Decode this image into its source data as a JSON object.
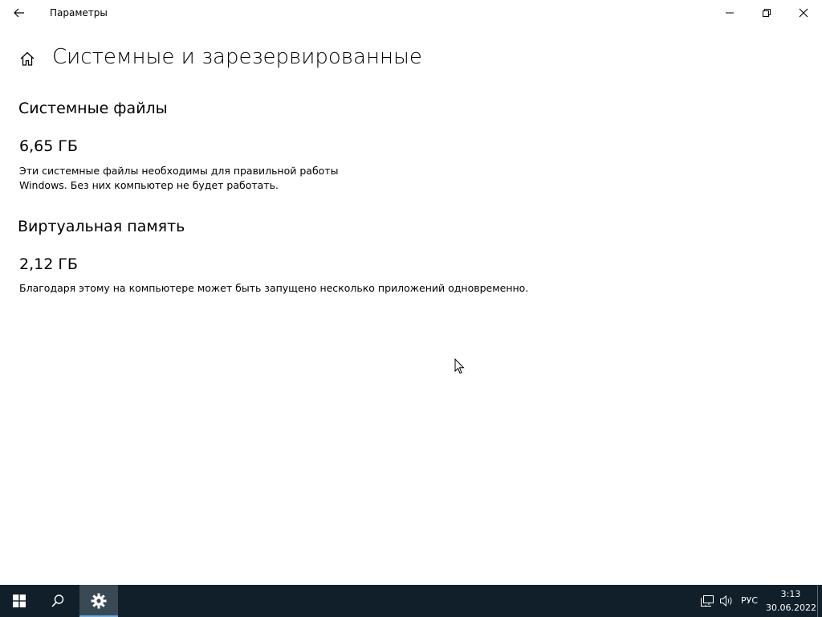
{
  "window": {
    "app_title": "Параметры"
  },
  "page": {
    "title": "Системные и зарезервированные"
  },
  "sections": [
    {
      "heading": "Системные файлы",
      "size": "6,65 ГБ",
      "description": "Эти системные файлы необходимы для правильной работы Windows. Без них компьютер не будет работать."
    },
    {
      "heading": "Виртуальная память",
      "size": "2,12 ГБ",
      "description": "Благодаря этому на компьютере может быть запущено несколько приложений одновременно."
    }
  ],
  "icons": {
    "back": "back-arrow-icon",
    "home": "home-icon",
    "minimize": "minimize-icon",
    "restore": "restore-icon",
    "close": "close-icon",
    "start": "windows-logo-icon",
    "search": "search-icon",
    "settings": "gear-icon",
    "network": "network-icon",
    "volume": "speaker-icon"
  },
  "taskbar": {
    "language": "РУС",
    "time": "3:13",
    "date": "30.06.2022"
  },
  "colors": {
    "taskbar_bg": "#101f2a",
    "active_app_bg": "#3a4a55",
    "active_indicator": "#6fa8dc"
  }
}
